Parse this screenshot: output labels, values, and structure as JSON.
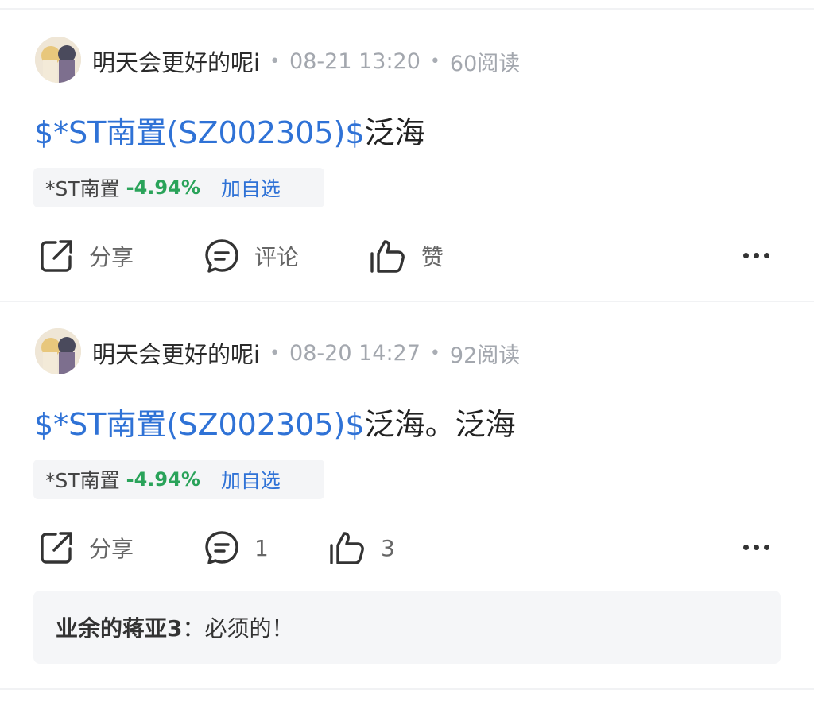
{
  "posts": [
    {
      "author": "明天会更好的呢i",
      "date": "08-21 13:20",
      "reads": "60阅读",
      "content_link": "$*ST南置(SZ002305)$",
      "content_text": "泛海",
      "stock": {
        "name": "*ST南置",
        "change": "-4.94%",
        "add_label": "加自选"
      },
      "actions": {
        "share": "分享",
        "comment": "评论",
        "like": "赞"
      }
    },
    {
      "author": "明天会更好的呢i",
      "date": "08-20 14:27",
      "reads": "92阅读",
      "content_link": "$*ST南置(SZ002305)$",
      "content_text": "泛海。泛海",
      "stock": {
        "name": "*ST南置",
        "change": "-4.94%",
        "add_label": "加自选"
      },
      "actions": {
        "share": "分享",
        "comment": "1",
        "like": "3"
      },
      "reply": {
        "author": "业余的蒋亚3",
        "separator": "：",
        "text": "必须的！"
      }
    }
  ],
  "colors": {
    "link": "#2f72d6",
    "down": "#2aa35a",
    "meta": "#a3a7ae"
  }
}
